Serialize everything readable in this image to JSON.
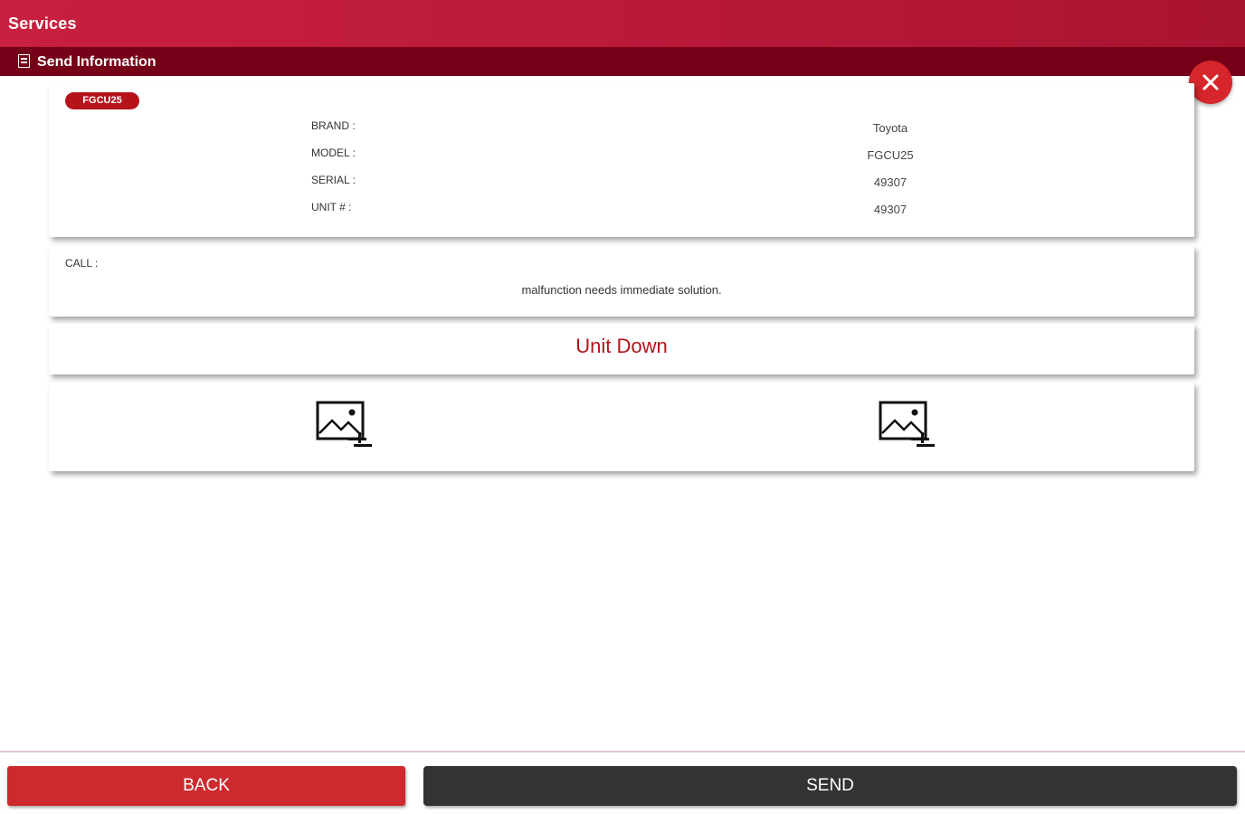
{
  "header": {
    "title": "Services",
    "subtitle": "Send Information"
  },
  "unit": {
    "badge": "FGCU25",
    "fields": [
      {
        "label": "BRAND :",
        "value": "Toyota"
      },
      {
        "label": "MODEL :",
        "value": "FGCU25"
      },
      {
        "label": "SERIAL :",
        "value": "49307"
      },
      {
        "label": "UNIT # :",
        "value": "49307"
      }
    ]
  },
  "call": {
    "label": "CALL :",
    "text": "malfunction needs immediate solution."
  },
  "status": {
    "text": "Unit Down"
  },
  "photos": {
    "icons": [
      "add-image-icon",
      "add-image-icon"
    ]
  },
  "footer": {
    "back_label": "BACK",
    "send_label": "SEND"
  },
  "colors": {
    "header_red": "#c8203f",
    "subheader_dark": "#760018",
    "accent_red": "#b5121b",
    "send_dark": "#333333"
  }
}
